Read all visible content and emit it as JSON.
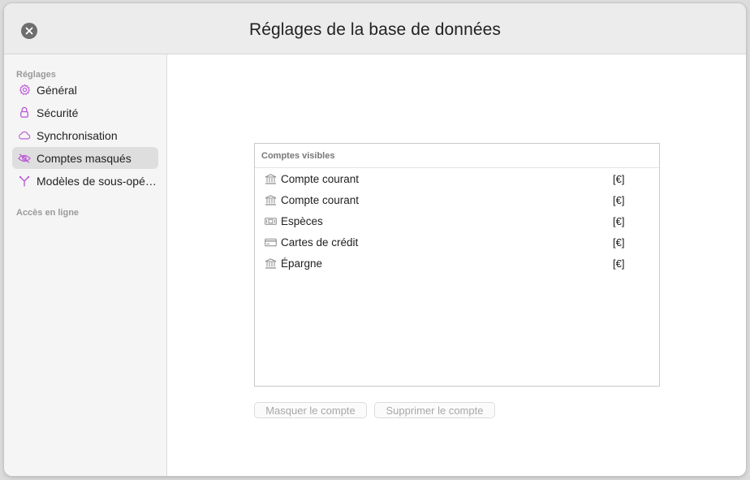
{
  "window": {
    "title": "Réglages de la base de données"
  },
  "sidebar": {
    "sections": [
      {
        "header": "Réglages"
      },
      {
        "header": "Accès en ligne"
      }
    ],
    "items": [
      {
        "label": "Général",
        "icon": "gear-icon"
      },
      {
        "label": "Sécurité",
        "icon": "lock-icon"
      },
      {
        "label": "Synchronisation",
        "icon": "cloud-icon"
      },
      {
        "label": "Comptes masqués",
        "icon": "eye-slash-icon",
        "selected": true
      },
      {
        "label": "Modèles de sous-opé…",
        "icon": "split-icon"
      }
    ]
  },
  "accounts_panel": {
    "header": "Comptes visibles",
    "rows": [
      {
        "name": "Compte courant",
        "currency": "[€]",
        "icon": "bank-icon"
      },
      {
        "name": "Compte courant",
        "currency": "[€]",
        "icon": "bank-icon"
      },
      {
        "name": "Espèces",
        "currency": "[€]",
        "icon": "cash-icon"
      },
      {
        "name": "Cartes de crédit",
        "currency": "[€]",
        "icon": "credit-card-icon"
      },
      {
        "name": "Épargne",
        "currency": "[€]",
        "icon": "bank-icon"
      }
    ]
  },
  "actions": {
    "hide_label": "Masquer le compte",
    "delete_label": "Supprimer le compte"
  },
  "colors": {
    "accent": "#b84fd6",
    "selected_bg": "#dedede",
    "disabled_text": "#a8a8a8"
  }
}
